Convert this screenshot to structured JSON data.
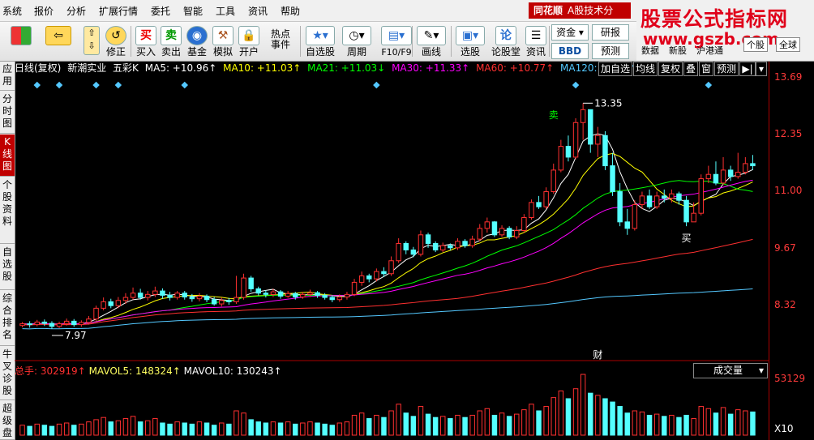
{
  "menu": [
    "系统",
    "报价",
    "分析",
    "扩展行情",
    "委托",
    "智能",
    "工具",
    "资讯",
    "帮助"
  ],
  "brand_logo": {
    "name": "同花顺",
    "sub": "A股技术分"
  },
  "watermark": {
    "line1": "股票公式指标网",
    "line2": "www.gszb.com"
  },
  "toolbar": {
    "buttons": [
      {
        "label": "",
        "icon": "windows-icon"
      },
      {
        "label": "",
        "icon": "back-arrow-icon"
      },
      {
        "label": "",
        "icon": "up-down-arrow-icon"
      },
      {
        "label": "修正",
        "icon": "refresh-icon"
      },
      {
        "label": "买入",
        "icon": "buy-icon",
        "glyph": "买"
      },
      {
        "label": "卖出",
        "icon": "sell-icon",
        "glyph": "卖"
      },
      {
        "label": "基金",
        "icon": "fund-icon"
      },
      {
        "label": "模拟",
        "icon": "gavel-icon"
      },
      {
        "label": "开户",
        "icon": "lock-icon"
      },
      {
        "label": "热点事件",
        "icon": "hot-icon"
      },
      {
        "label": "自选股",
        "icon": "star-list-icon"
      },
      {
        "label": "周期",
        "icon": "clock-icon"
      },
      {
        "label": "F10/F9",
        "icon": "f10-icon"
      },
      {
        "label": "画线",
        "icon": "pen-icon"
      },
      {
        "label": "选股",
        "icon": "screen-icon"
      },
      {
        "label": "论股堂",
        "icon": "discuss-icon",
        "glyph": "论"
      },
      {
        "label": "资讯",
        "icon": "news-icon"
      }
    ],
    "small": {
      "zijin": "资金",
      "bbd": "BBD",
      "yanbao": "研报",
      "yuce": "预测",
      "shuju": "数据",
      "xingu": "新股",
      "hugangtong": "沪港通",
      "quanqiu": "全球",
      "geguzhong": "个股"
    }
  },
  "left_tabs": [
    "应用",
    "分时图",
    "K线图",
    "个股资料",
    "自选股",
    "综合排名",
    "牛叉诊股",
    "超级盘"
  ],
  "info": {
    "period": "日线(复权)",
    "stock": "新潮实业",
    "mode": "五彩K",
    "ma5": "MA5: +10.96↑",
    "ma10": "MA10: +11.03↑",
    "ma21": "MA21: +11.03↓",
    "ma30": "MA30: +11.33↑",
    "ma60": "MA60: +10.77↑",
    "ma120": "MA120: +9.78↑"
  },
  "right_buttons": [
    "加自选",
    "均线",
    "复权",
    "叠",
    "窗",
    "预测"
  ],
  "axis_labels": [
    "13.69",
    "12.35",
    "11.00",
    "9.67",
    "8.32"
  ],
  "annotations": {
    "high": "13.35",
    "low": "7.97",
    "sell": "卖",
    "buy": "买",
    "fin": "财"
  },
  "volume": {
    "total": "总手: 302919↑",
    "mavol5": "MAVOL5: 148324↑",
    "mavol10": "MAVOL10: 130243↑",
    "dropdown": "成交量",
    "axis_top": "53129",
    "unit": "X10"
  },
  "colors": {
    "up": "#ff3030",
    "down": "#54ffff",
    "ma5": "#ffffff",
    "ma10": "#ffff00",
    "ma21": "#00ff00",
    "ma30": "#ff00ff",
    "ma60": "#ff3030",
    "ma120": "#54c8ff"
  },
  "chart_data": {
    "type": "candlestick",
    "ylim": [
      7.5,
      13.9
    ],
    "candles": [
      [
        8.2,
        8.24,
        8.28,
        8.16
      ],
      [
        8.24,
        8.22,
        8.3,
        8.15
      ],
      [
        8.22,
        8.28,
        8.33,
        8.18
      ],
      [
        8.28,
        8.25,
        8.34,
        8.19
      ],
      [
        8.25,
        8.18,
        8.3,
        8.12
      ],
      [
        8.18,
        8.24,
        8.29,
        8.14
      ],
      [
        8.24,
        8.3,
        8.36,
        8.2
      ],
      [
        8.3,
        8.22,
        8.35,
        8.17
      ],
      [
        8.22,
        8.27,
        8.32,
        8.17
      ],
      [
        8.27,
        8.35,
        8.42,
        8.22
      ],
      [
        8.35,
        8.6,
        8.66,
        8.3
      ],
      [
        8.6,
        8.75,
        8.85,
        8.55
      ],
      [
        8.75,
        8.66,
        8.82,
        8.6
      ],
      [
        8.66,
        8.78,
        8.86,
        8.6
      ],
      [
        8.78,
        8.85,
        8.95,
        8.7
      ],
      [
        8.85,
        8.95,
        9.08,
        8.8
      ],
      [
        8.95,
        8.85,
        9.05,
        8.8
      ],
      [
        8.85,
        8.92,
        9.0,
        8.78
      ],
      [
        8.92,
        9.0,
        9.1,
        8.86
      ],
      [
        9.0,
        8.9,
        9.06,
        8.82
      ],
      [
        8.9,
        8.85,
        8.98,
        8.78
      ],
      [
        8.85,
        8.95,
        9.0,
        8.8
      ],
      [
        8.95,
        8.86,
        9.0,
        8.8
      ],
      [
        8.86,
        8.82,
        8.93,
        8.75
      ],
      [
        8.82,
        8.88,
        8.95,
        8.76
      ],
      [
        8.88,
        8.8,
        8.92,
        8.74
      ],
      [
        8.8,
        8.7,
        8.86,
        8.66
      ],
      [
        8.7,
        8.78,
        8.85,
        8.64
      ],
      [
        8.78,
        8.75,
        8.84,
        8.68
      ],
      [
        8.75,
        8.85,
        9.35,
        8.7
      ],
      [
        8.85,
        9.3,
        9.4,
        8.8
      ],
      [
        9.3,
        9.05,
        9.35,
        8.98
      ],
      [
        9.05,
        8.95,
        9.1,
        8.9
      ],
      [
        8.95,
        8.92,
        9.02,
        8.85
      ],
      [
        8.92,
        8.98,
        9.05,
        8.86
      ],
      [
        8.98,
        8.88,
        9.02,
        8.82
      ],
      [
        8.88,
        8.94,
        9.0,
        8.84
      ],
      [
        8.94,
        8.86,
        8.98,
        8.8
      ],
      [
        8.86,
        8.92,
        8.98,
        8.82
      ],
      [
        8.92,
        8.96,
        9.03,
        8.86
      ],
      [
        8.96,
        8.9,
        9.0,
        8.84
      ],
      [
        8.9,
        8.85,
        8.95,
        8.8
      ],
      [
        8.85,
        8.8,
        8.9,
        8.74
      ],
      [
        8.8,
        8.86,
        8.92,
        8.75
      ],
      [
        8.86,
        8.92,
        8.98,
        8.8
      ],
      [
        8.92,
        9.2,
        9.28,
        8.88
      ],
      [
        9.2,
        9.35,
        9.45,
        9.12
      ],
      [
        9.35,
        9.28,
        9.4,
        9.2
      ],
      [
        9.28,
        9.45,
        9.52,
        9.22
      ],
      [
        9.45,
        9.4,
        9.55,
        9.32
      ],
      [
        9.4,
        9.7,
        9.8,
        9.35
      ],
      [
        9.7,
        10.1,
        10.22,
        9.65
      ],
      [
        10.1,
        9.95,
        10.15,
        9.85
      ],
      [
        9.95,
        9.85,
        10.02,
        9.78
      ],
      [
        9.85,
        10.3,
        10.4,
        9.8
      ],
      [
        10.3,
        10.1,
        10.35,
        10.0
      ],
      [
        10.1,
        9.95,
        10.15,
        9.9
      ],
      [
        9.95,
        10.05,
        10.12,
        9.9
      ],
      [
        10.05,
        10.0,
        10.1,
        9.94
      ],
      [
        10.0,
        10.15,
        10.22,
        9.95
      ],
      [
        10.15,
        10.05,
        10.2,
        10.0
      ],
      [
        10.05,
        10.2,
        10.28,
        10.0
      ],
      [
        10.2,
        10.45,
        10.55,
        10.15
      ],
      [
        10.45,
        10.6,
        10.7,
        10.35
      ],
      [
        10.6,
        10.3,
        10.62,
        10.25
      ],
      [
        10.3,
        10.45,
        10.52,
        10.25
      ],
      [
        10.45,
        10.25,
        10.5,
        10.2
      ],
      [
        10.25,
        10.4,
        10.5,
        10.2
      ],
      [
        10.4,
        10.7,
        10.78,
        10.35
      ],
      [
        10.7,
        11.05,
        11.12,
        10.65
      ],
      [
        11.05,
        10.95,
        11.2,
        10.9
      ],
      [
        10.95,
        11.3,
        11.4,
        10.9
      ],
      [
        11.3,
        11.8,
        11.95,
        11.25
      ],
      [
        11.8,
        12.35,
        12.5,
        11.75
      ],
      [
        12.35,
        12.1,
        12.6,
        12.0
      ],
      [
        12.1,
        12.9,
        13.0,
        12.05
      ],
      [
        12.9,
        13.2,
        13.35,
        12.5
      ],
      [
        13.2,
        12.4,
        13.1,
        12.2
      ],
      [
        12.4,
        12.6,
        12.8,
        12.1
      ],
      [
        12.6,
        11.9,
        12.7,
        11.8
      ],
      [
        11.9,
        11.3,
        12.2,
        11.2
      ],
      [
        11.3,
        10.6,
        11.5,
        10.5
      ],
      [
        10.6,
        10.45,
        10.9,
        10.3
      ],
      [
        10.45,
        11.0,
        11.1,
        10.4
      ],
      [
        11.0,
        11.2,
        11.3,
        10.9
      ],
      [
        11.2,
        10.95,
        11.35,
        10.9
      ],
      [
        10.95,
        11.2,
        11.3,
        10.9
      ],
      [
        11.2,
        11.15,
        11.35,
        11.05
      ],
      [
        11.15,
        11.25,
        11.35,
        11.05
      ],
      [
        11.25,
        11.1,
        11.3,
        11.0
      ],
      [
        11.1,
        10.6,
        11.2,
        10.5
      ],
      [
        10.6,
        10.8,
        11.05,
        10.6
      ],
      [
        10.8,
        11.6,
        11.7,
        10.75
      ],
      [
        11.6,
        11.7,
        11.9,
        11.5
      ],
      [
        11.7,
        11.5,
        12.0,
        11.45
      ],
      [
        11.5,
        11.8,
        12.1,
        11.45
      ],
      [
        11.8,
        11.65,
        11.9,
        11.55
      ],
      [
        11.65,
        11.75,
        12.2,
        11.6
      ],
      [
        11.75,
        11.95,
        12.1,
        11.7
      ],
      [
        11.95,
        11.9,
        12.15,
        11.8
      ]
    ],
    "volume": [
      9,
      8,
      10,
      9,
      8,
      10,
      11,
      9,
      10,
      12,
      14,
      16,
      12,
      13,
      15,
      17,
      12,
      13,
      15,
      11,
      10,
      12,
      11,
      10,
      12,
      11,
      9,
      11,
      10,
      22,
      20,
      14,
      12,
      11,
      12,
      11,
      12,
      10,
      11,
      12,
      11,
      10,
      9,
      11,
      12,
      18,
      20,
      15,
      18,
      16,
      22,
      28,
      20,
      17,
      26,
      19,
      16,
      17,
      15,
      18,
      16,
      18,
      22,
      24,
      18,
      20,
      17,
      19,
      23,
      28,
      22,
      26,
      34,
      40,
      33,
      42,
      55,
      38,
      36,
      33,
      30,
      26,
      20,
      22,
      21,
      18,
      19,
      17,
      18,
      16,
      18,
      15,
      26,
      24,
      20,
      25,
      19,
      23,
      22,
      21
    ]
  }
}
